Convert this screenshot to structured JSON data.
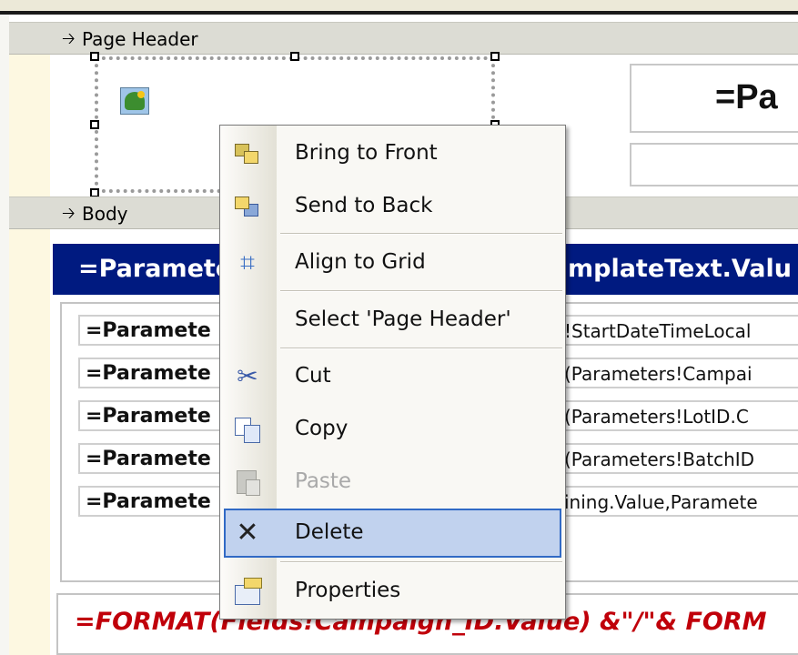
{
  "sections": {
    "page_header_label": "Page Header",
    "body_label": "Body"
  },
  "header": {
    "title_text": "=Pa"
  },
  "body": {
    "blue_bar_left": "=Paramete",
    "blue_bar_right": "mplateText.Valu",
    "rows": [
      {
        "label": "=Paramete",
        "value": "!StartDateTimeLocal"
      },
      {
        "label": "=Paramete",
        "value": "(Parameters!Campai"
      },
      {
        "label": "=Paramete",
        "value": "(Parameters!LotID.C"
      },
      {
        "label": "=Paramete",
        "value": "(Parameters!BatchID"
      },
      {
        "label": "=Paramete",
        "value": "ining.Value,Paramete"
      }
    ],
    "footer_expression": "=FORMAT(Fields!Campaign_ID.Value) &\"/\"& FORM"
  },
  "context_menu": {
    "items": [
      {
        "label": "Bring to Front",
        "icon": "bring-to-front-icon",
        "enabled": true
      },
      {
        "label": "Send to Back",
        "icon": "send-to-back-icon",
        "enabled": true
      },
      {
        "label": "Align to Grid",
        "icon": "align-to-grid-icon",
        "enabled": true
      },
      {
        "label": "Select 'Page Header'",
        "icon": "",
        "enabled": true
      },
      {
        "label": "Cut",
        "icon": "scissors-icon",
        "enabled": true
      },
      {
        "label": "Copy",
        "icon": "copy-icon",
        "enabled": true
      },
      {
        "label": "Paste",
        "icon": "paste-icon",
        "enabled": false
      },
      {
        "label": "Delete",
        "icon": "delete-x-icon",
        "enabled": true,
        "highlighted": true
      },
      {
        "label": "Properties",
        "icon": "properties-icon",
        "enabled": true
      }
    ]
  },
  "colors": {
    "header_bar_blue": "#001a80",
    "footer_text_red": "#c0000a",
    "menu_highlight": "#c1d2ee"
  }
}
